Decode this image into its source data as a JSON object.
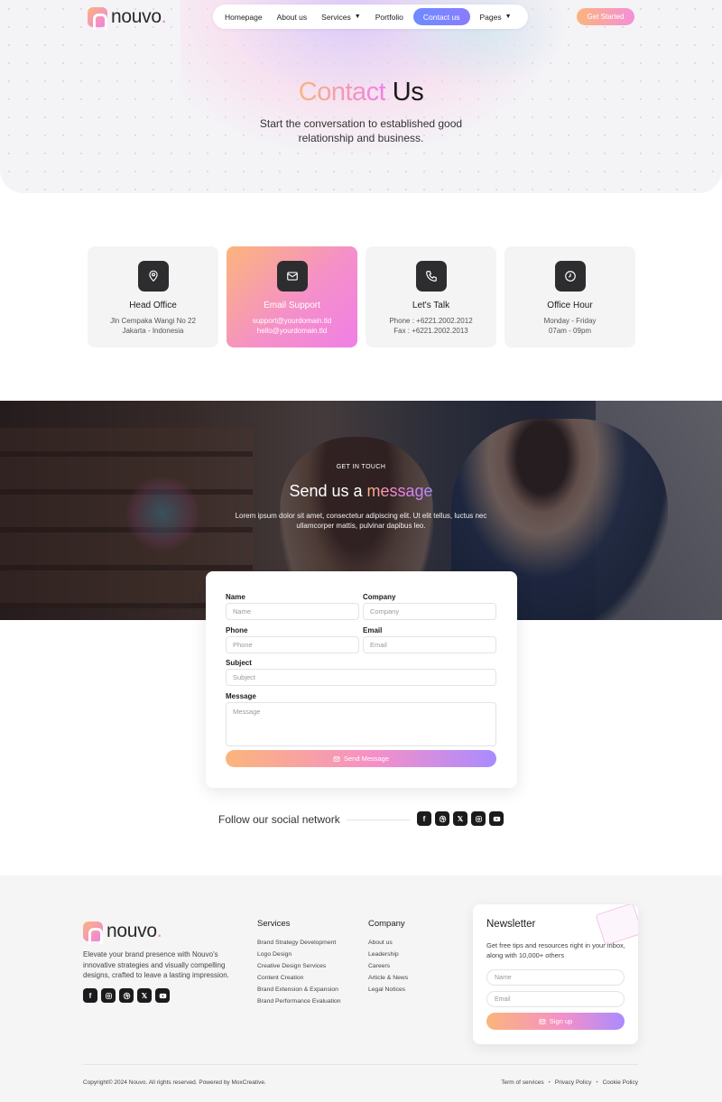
{
  "brand": {
    "name": "nouvo",
    "dot": "."
  },
  "nav": {
    "items": [
      {
        "label": "Homepage",
        "dropdown": false,
        "active": false
      },
      {
        "label": "About us",
        "dropdown": false,
        "active": false
      },
      {
        "label": "Services",
        "dropdown": true,
        "active": false
      },
      {
        "label": "Portfolio",
        "dropdown": false,
        "active": false
      },
      {
        "label": "Contact us",
        "dropdown": false,
        "active": true
      },
      {
        "label": "Pages",
        "dropdown": true,
        "active": false
      }
    ],
    "cta": "Get Started"
  },
  "hero": {
    "title_highlight": "Contact",
    "title_rest": " Us",
    "subtitle": "Start the conversation to established good relationship and business."
  },
  "cards": [
    {
      "icon": "map-pin-icon",
      "title": "Head Office",
      "lines": [
        "Jln Cempaka Wangi No 22",
        "Jakarta - Indonesia"
      ],
      "highlight": false
    },
    {
      "icon": "envelope-icon",
      "title": "Email Support",
      "lines": [
        "support@yourdomain.tld",
        "hello@yourdomain.tld"
      ],
      "highlight": true
    },
    {
      "icon": "phone-icon",
      "title": "Let's Talk",
      "lines": [
        "Phone : +6221.2002.2012",
        "Fax : +6221.2002.2013"
      ],
      "highlight": false
    },
    {
      "icon": "clock-icon",
      "title": "Office Hour",
      "lines": [
        "Monday - Friday",
        "07am - 09pm"
      ],
      "highlight": false
    }
  ],
  "banner": {
    "eyebrow": "GET IN TOUCH",
    "title_plain": "Send us a ",
    "title_highlight": "message",
    "description": "Lorem ipsum dolor sit amet, consectetur adipiscing elit. Ut elit tellus, luctus nec ullamcorper mattis, pulvinar dapibus leo."
  },
  "form": {
    "name": {
      "label": "Name",
      "placeholder": "Name"
    },
    "company": {
      "label": "Company",
      "placeholder": "Company"
    },
    "phone": {
      "label": "Phone",
      "placeholder": "Phone"
    },
    "email": {
      "label": "Email",
      "placeholder": "Email"
    },
    "subject": {
      "label": "Subject",
      "placeholder": "Subject"
    },
    "message": {
      "label": "Message",
      "placeholder": "Message"
    },
    "submit": "Send Message"
  },
  "social": {
    "label": "Follow our social network",
    "icons": [
      "facebook-icon",
      "dribbble-icon",
      "x-icon",
      "instagram-icon",
      "youtube-icon"
    ]
  },
  "footer": {
    "about": "Elevate your brand presence with Nouvo's innovative strategies and visually compelling designs, crafted to leave a lasting impression.",
    "social_icons": [
      "facebook-icon",
      "instagram-icon",
      "dribbble-icon",
      "x-icon",
      "youtube-icon"
    ],
    "services": {
      "title": "Services",
      "items": [
        "Brand Strategy Development",
        "Logo Design",
        "Creative Design Services",
        "Content Creation",
        "Brand Extension & Expansion",
        "Brand Performance Evaluation"
      ]
    },
    "company": {
      "title": "Company",
      "items": [
        "About us",
        "Leadership",
        "Careers",
        "Article & News",
        "Legal Notices"
      ]
    },
    "newsletter": {
      "title": "Newsletter",
      "text": "Get free tips and resources right in your inbox, along with 10,000+ others",
      "name_placeholder": "Name",
      "email_placeholder": "Email",
      "button": "Sign up"
    },
    "copyright": "Copyright© 2024 Nouvo. All rights reserved. Powered by MoxCreative.",
    "legal": [
      "Term of services",
      "Privacy Policy",
      "Cookie Policy"
    ]
  },
  "colors": {
    "gradient_start": "#fbb57b",
    "gradient_end": "#f07fe6",
    "nav_active": "#7a84ff",
    "dark_icon_bg": "#2d2d2f"
  }
}
